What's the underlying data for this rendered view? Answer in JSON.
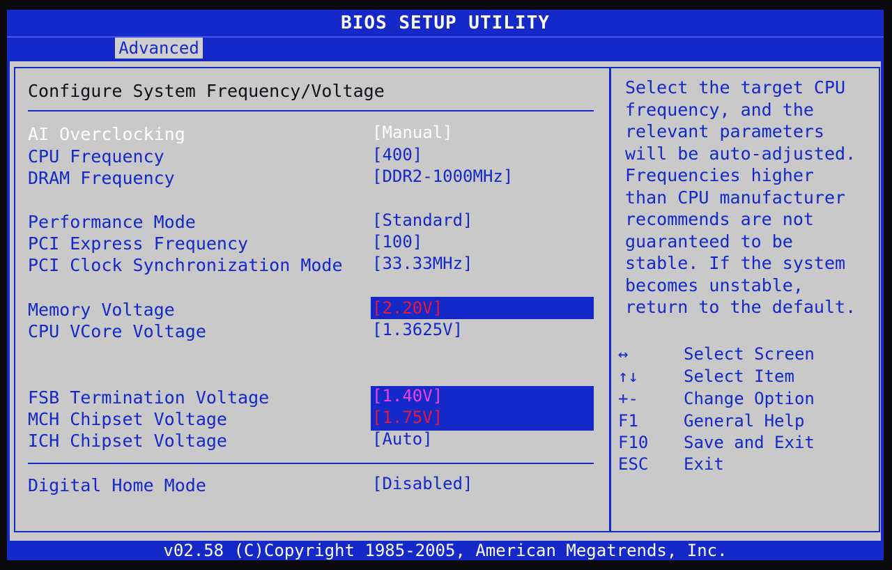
{
  "title": "BIOS SETUP UTILITY",
  "tabs": [
    {
      "label": "Advanced",
      "active": true
    }
  ],
  "section_title": "Configure System Frequency/Voltage",
  "settings": [
    {
      "label": "AI Overclocking",
      "value": "[Manual]",
      "selected": true
    },
    {
      "label": "CPU Frequency",
      "value": "[400]"
    },
    {
      "label": "DRAM Frequency",
      "value": "[DDR2-1000MHz]"
    },
    {
      "label": "Performance Mode",
      "value": "[Standard]"
    },
    {
      "label": "PCI Express Frequency",
      "value": "[100]"
    },
    {
      "label": "PCI Clock Synchronization Mode",
      "value": "[33.33MHz]"
    },
    {
      "label": "Memory Voltage",
      "value": "[2.20V]",
      "highlight": "red"
    },
    {
      "label": "CPU VCore Voltage",
      "value": "[1.3625V]"
    },
    {
      "label": "FSB Termination Voltage",
      "value": "[1.40V]",
      "highlight": "magenta"
    },
    {
      "label": "MCH Chipset Voltage",
      "value": "[1.75V]",
      "highlight": "red"
    },
    {
      "label": "ICH Chipset Voltage",
      "value": "[Auto]"
    },
    {
      "label": "Digital Home Mode",
      "value": "[Disabled]"
    }
  ],
  "help_lines": [
    "Select the target CPU",
    "frequency, and the",
    "relevant parameters",
    "will be auto-adjusted.",
    "Frequencies higher",
    "than CPU manufacturer",
    "recommends are not",
    "guaranteed to be",
    "stable. If the system",
    "becomes unstable,",
    "return to the default."
  ],
  "key_legend": [
    {
      "key": "↔",
      "desc": "Select Screen"
    },
    {
      "key": "↑↓",
      "desc": "Select Item"
    },
    {
      "key": "+-",
      "desc": "Change Option"
    },
    {
      "key": "F1",
      "desc": "General Help"
    },
    {
      "key": "F10",
      "desc": "Save and Exit"
    },
    {
      "key": "ESC",
      "desc": "Exit"
    }
  ],
  "footer": "v02.58 (C)Copyright 1985-2005, American Megatrends, Inc.",
  "colors": {
    "bios_blue": "#1528c8",
    "panel_gray": "#c9c9c9",
    "warning_red": "#e8183a",
    "warning_magenta": "#f040e0"
  }
}
